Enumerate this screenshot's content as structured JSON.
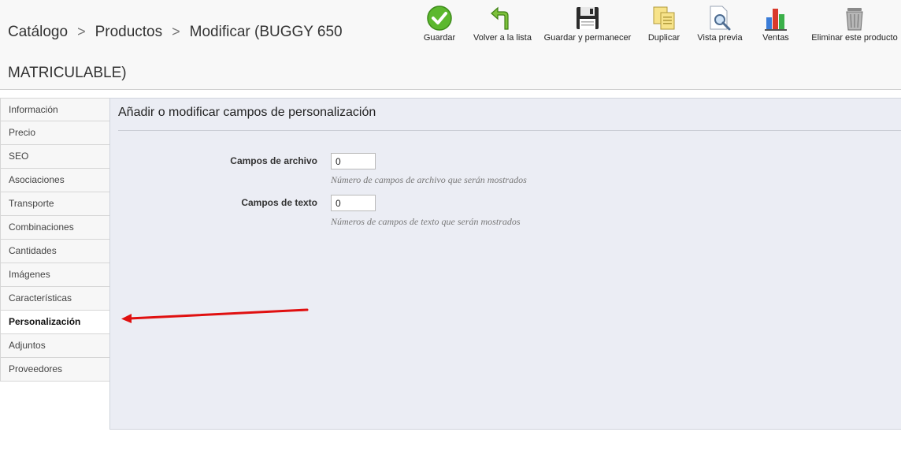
{
  "header": {
    "breadcrumb": [
      "Catálogo",
      "Productos",
      "Modificar (BUGGY 650 MATRICULABLE)"
    ],
    "separator": ">"
  },
  "toolbar": {
    "save": "Guardar",
    "back": "Volver a la lista",
    "save_stay": "Guardar y permanecer",
    "duplicate": "Duplicar",
    "preview": "Vista previa",
    "sales": "Ventas",
    "delete": "Eliminar este producto"
  },
  "sidebar": {
    "items": [
      {
        "label": "Información"
      },
      {
        "label": "Precio"
      },
      {
        "label": "SEO"
      },
      {
        "label": "Asociaciones"
      },
      {
        "label": "Transporte"
      },
      {
        "label": "Combinaciones"
      },
      {
        "label": "Cantidades"
      },
      {
        "label": "Imágenes"
      },
      {
        "label": "Características"
      },
      {
        "label": "Personalización",
        "active": true
      },
      {
        "label": "Adjuntos"
      },
      {
        "label": "Proveedores"
      }
    ]
  },
  "main": {
    "title": "Añadir o modificar campos de personalización",
    "file_fields": {
      "label": "Campos de archivo",
      "value": "0",
      "hint": "Número de campos de archivo que serán mostrados"
    },
    "text_fields": {
      "label": "Campos de texto",
      "value": "0",
      "hint": "Números de campos de texto que serán mostrados"
    }
  },
  "colors": {
    "annotation_arrow": "#e01010",
    "panel_bg": "#ebedf4"
  }
}
